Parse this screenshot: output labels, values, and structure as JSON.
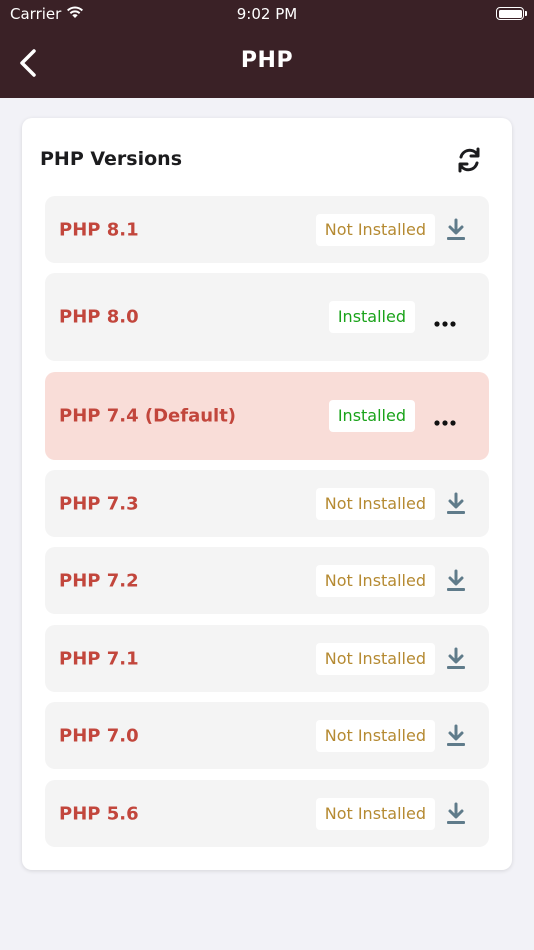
{
  "status_bar": {
    "carrier": "Carrier",
    "time": "9:02 PM"
  },
  "nav": {
    "title": "PHP"
  },
  "card": {
    "title": "PHP Versions"
  },
  "versions": [
    {
      "label": "PHP 8.1",
      "status": "Not Installed",
      "action_icon": "download-icon"
    },
    {
      "label": "PHP 8.0",
      "status": "Installed",
      "action_icon": "more-icon"
    },
    {
      "label": "PHP 7.4 (Default)",
      "status": "Installed",
      "action_icon": "more-icon",
      "default": true
    },
    {
      "label": "PHP 7.3",
      "status": "Not Installed",
      "action_icon": "download-icon"
    },
    {
      "label": "PHP 7.2",
      "status": "Not Installed",
      "action_icon": "download-icon"
    },
    {
      "label": "PHP 7.1",
      "status": "Not Installed",
      "action_icon": "download-icon"
    },
    {
      "label": "PHP 7.0",
      "status": "Not Installed",
      "action_icon": "download-icon"
    },
    {
      "label": "PHP 5.6",
      "status": "Not Installed",
      "action_icon": "download-icon"
    }
  ],
  "colors": {
    "nav_background": "#3a2126",
    "version_label": "#c2463c",
    "installed": "#1aa31a",
    "not_installed": "#b58a32",
    "default_row": "#f9ddd8",
    "download_icon": "#5f7b8a"
  }
}
